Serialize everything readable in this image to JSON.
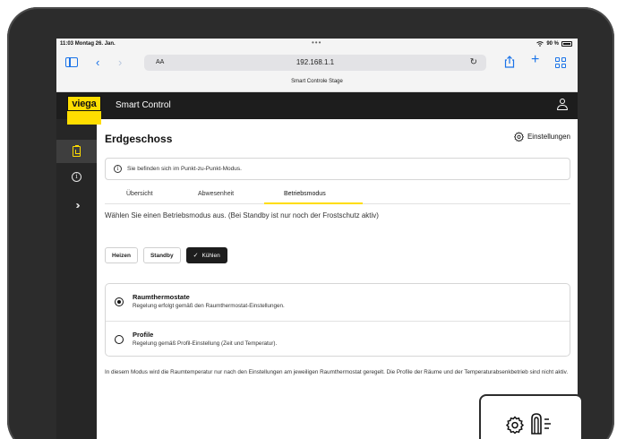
{
  "status_bar": {
    "time": "11:03",
    "date": "Montag 26. Jan.",
    "dots": "•••",
    "battery": "90 %"
  },
  "browser": {
    "text_size": "AA",
    "url": "192.168.1.1",
    "tab_title": "Smart Controle Stage",
    "accent_color": "#1a73e8"
  },
  "app": {
    "logo_text": "viega",
    "title": "Smart Control",
    "brand_color": "#ffdd00"
  },
  "page": {
    "title": "Erdgeschoss",
    "settings_label": "Einstellungen",
    "info_message": "Sie befinden sich im Punkt-zu-Punkt-Modus.",
    "tabs": [
      {
        "label": "Übersicht"
      },
      {
        "label": "Abwesenheit"
      },
      {
        "label": "Betriebsmodus"
      }
    ],
    "active_tab": "Betriebsmodus",
    "instruction": "Wählen Sie einen Betriebsmodus aus. (Bei Standby ist nur noch der Frostschutz aktiv)",
    "mode_buttons": [
      {
        "label": "Heizen"
      },
      {
        "label": "Standby"
      },
      {
        "label": "Kühlen"
      }
    ],
    "active_mode": "Kühlen",
    "options": [
      {
        "title": "Raumthermostate",
        "description": "Regelung erfolgt gemäß den Raumthermostat-Einstellungen."
      },
      {
        "title": "Profile",
        "description": "Regelung gemäß Profil-Einstellung (Zeit und Temperatur)."
      }
    ],
    "selected_option": "Raumthermostate",
    "footnote": "In diesem Modus wird die Raumtemperatur nur nach den Einstellungen am jeweiligen Raumthermostat geregelt. Die Profile der Räume und der Temperaturabsenkbetrieb sind nicht aktiv."
  },
  "icons": {
    "rail": [
      "clipboard-icon",
      "info-icon",
      "chevrons-right-icon"
    ],
    "overlay": [
      "gear-icon",
      "thermostat-icon"
    ]
  }
}
